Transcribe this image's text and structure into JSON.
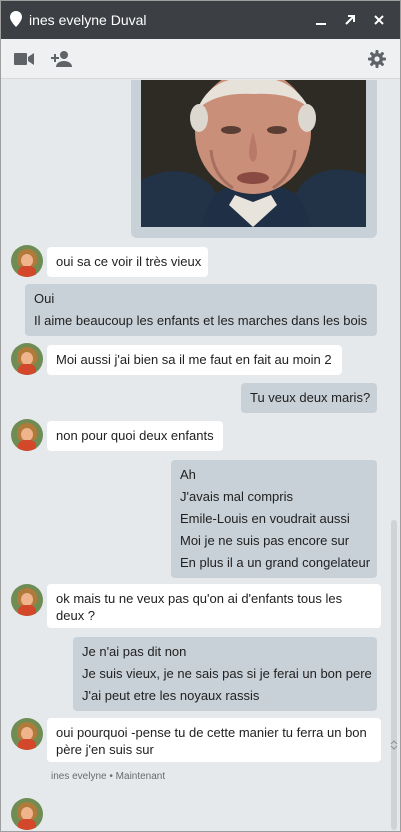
{
  "window": {
    "title": "ines evelyne Duval"
  },
  "titlebar": {
    "icons": [
      "location-pin-icon",
      "minimize-icon",
      "popout-icon",
      "close-icon"
    ]
  },
  "toolbar": {
    "icons": [
      "video-call-icon",
      "add-person-icon",
      "settings-gear-icon"
    ]
  },
  "colors": {
    "titlebar": "#3c3f43",
    "background": "#e5e9ec",
    "incoming_bubble": "#ffffff",
    "outgoing_bubble": "#c9d1d8"
  },
  "messages": [
    {
      "from": "them",
      "lines": [
        "oui sa ce voir il très vieux"
      ]
    },
    {
      "from": "me",
      "lines": [
        "Oui",
        "Il aime beaucoup les enfants et les marches dans les bois"
      ]
    },
    {
      "from": "them",
      "lines": [
        "Moi aussi j'ai bien sa il me faut en fait au moin 2"
      ]
    },
    {
      "from": "me",
      "lines": [
        "Tu veux deux maris?"
      ]
    },
    {
      "from": "them",
      "lines": [
        "non pour quoi deux enfants"
      ]
    },
    {
      "from": "me",
      "lines": [
        "Ah",
        "J'avais mal compris",
        "Emile-Louis en voudrait aussi",
        "Moi je ne suis pas encore sur",
        "En plus il a un grand congelateur"
      ]
    },
    {
      "from": "them",
      "lines": [
        "ok mais tu ne veux pas qu'on ai d'enfants tous les deux ?"
      ]
    },
    {
      "from": "me",
      "lines": [
        "Je n'ai pas dit non",
        "Je suis vieux, je ne sais pas si je ferai un bon pere",
        "J'ai peut etre les noyaux rassis"
      ]
    },
    {
      "from": "them",
      "lines": [
        "oui pourquoi -pense tu de cette manier tu ferra un bon père j'en suis sur"
      ]
    }
  ],
  "status": {
    "sender": "ines evelyne",
    "separator": "•",
    "time": "Maintenant"
  }
}
